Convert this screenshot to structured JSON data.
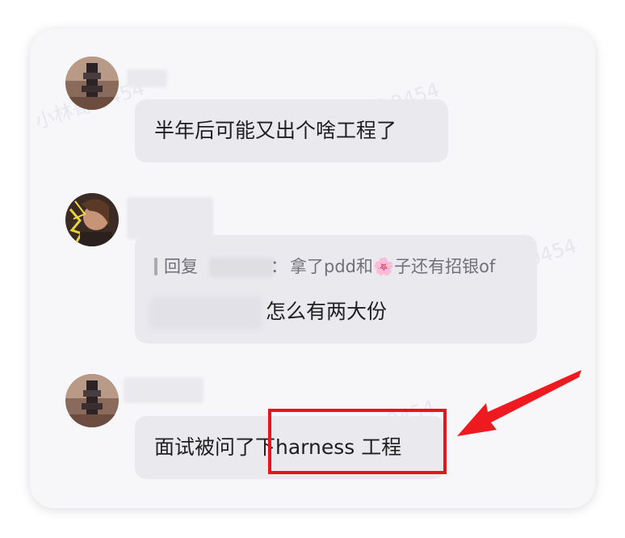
{
  "watermark_text": "小林哥 9454",
  "messages": [
    {
      "text": "半年后可能又出个啥工程了"
    },
    {
      "reply": {
        "prefix": "回复",
        "separator": "：",
        "content": "拿了pdd和🌸子还有招银of"
      },
      "text": "怎么有两大份"
    },
    {
      "text_before": "面试被问了",
      "text_highlight": "下harness 工程"
    }
  ],
  "colors": {
    "highlight": "#e8141a",
    "bubble": "#e9e9ee",
    "card": "#f7f7f9"
  }
}
